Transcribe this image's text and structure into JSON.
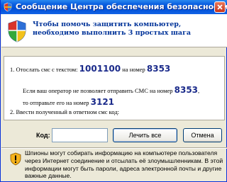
{
  "window": {
    "title": "Сообщение Центра обеспечения безопасности"
  },
  "header": {
    "text": "Чтобы помочь защитить компьютер, необходимо выполнить 3 простых шага"
  },
  "instructions": {
    "step1_prefix": "1. Отослать смс с текстом:",
    "sms_text": "1001100",
    "step1_mid": "на номер",
    "number1": "8353",
    "alt_line1": "Если ваш оператор не позволяет отправить СМС на номер",
    "alt_number1": "8353",
    "alt_comma": ",",
    "alt_line2": "то отправьте его на номер",
    "number2": "3121",
    "step2": "2. Ввести полученный в ответном смс код:"
  },
  "form": {
    "code_label": "Код:",
    "code_value": "",
    "ok_button": "Лечить все",
    "cancel_button": "Отмена"
  },
  "footer": {
    "text": "Шпионы могут собирать информацию на компьютере пользователя через Интернет соединение и отсылать её злоумышленникам. В этой информации могут быть пароли, адреса электронной почты и другие важные данные."
  },
  "colors": {
    "titlebar": "#0a5ee0",
    "header_text": "#003399",
    "number_text": "#1a2a8a"
  }
}
